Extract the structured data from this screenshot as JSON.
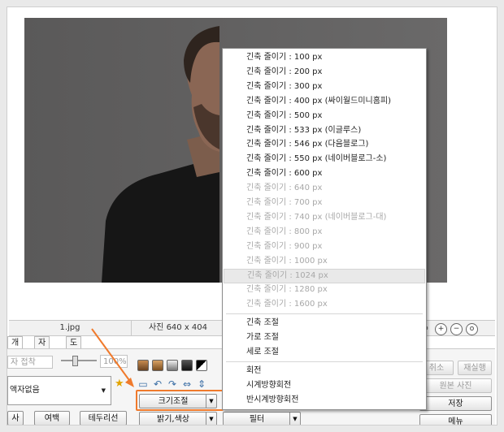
{
  "photo": {
    "background": "#605f5f"
  },
  "status": {
    "filename": "1.jpg",
    "dimensions": "사진 640 x 404",
    "zoom_suffix": "%"
  },
  "tabs": [
    {
      "label": "개체"
    },
    {
      "label": "자르기"
    },
    {
      "label": "도구"
    }
  ],
  "left_panel": {
    "partial_input": "자 접착",
    "slider_value": "100%",
    "frame_select_value": "액자없음",
    "button_photo": "사진",
    "button_margin": "여백",
    "button_border": "테두리선"
  },
  "center_panel": {
    "resize_button": "크기조절",
    "brightness_button": "밝기,색상",
    "filter_button": "필터"
  },
  "right_panel": {
    "cancel": "취소",
    "redo": "재실행",
    "original": "원본 사진",
    "save": "저장",
    "menu": "메뉴"
  },
  "resize_menu": {
    "items": [
      {
        "label": "긴축 줄이기 : 100 px",
        "disabled": false
      },
      {
        "label": "긴축 줄이기 : 200 px",
        "disabled": false
      },
      {
        "label": "긴축 줄이기 : 300 px",
        "disabled": false
      },
      {
        "label": "긴축 줄이기 : 400 px (싸이월드미니홈피)",
        "disabled": false
      },
      {
        "label": "긴축 줄이기 : 500 px",
        "disabled": false
      },
      {
        "label": "긴축 줄이기 : 533 px (이글루스)",
        "disabled": false
      },
      {
        "label": "긴축 줄이기 : 546 px (다음블로그)",
        "disabled": false
      },
      {
        "label": "긴축 줄이기 : 550 px (네이버블로그-소)",
        "disabled": false
      },
      {
        "label": "긴축 줄이기 : 600 px",
        "disabled": false
      },
      {
        "label": "긴축 줄이기 : 640 px",
        "disabled": true
      },
      {
        "label": "긴축 줄이기 : 700 px",
        "disabled": true
      },
      {
        "label": "긴축 줄이기 : 740 px (네이버블로그-대)",
        "disabled": true
      },
      {
        "label": "긴축 줄이기 : 800 px",
        "disabled": true
      },
      {
        "label": "긴축 줄이기 : 900 px",
        "disabled": true
      },
      {
        "label": "긴축 줄이기 : 1000 px",
        "disabled": true
      },
      {
        "label": "긴축 줄이기 : 1024 px",
        "disabled": true,
        "highlighted": true
      },
      {
        "label": "긴축 줄이기 : 1280 px",
        "disabled": true
      },
      {
        "label": "긴축 줄이기 : 1600 px",
        "disabled": true
      }
    ],
    "group2": [
      {
        "label": "긴축 조절"
      },
      {
        "label": "가로 조절"
      },
      {
        "label": "세로 조절"
      }
    ],
    "group3": [
      {
        "label": "회전"
      },
      {
        "label": "시계방향회전"
      },
      {
        "label": "반시계방향회전"
      }
    ]
  },
  "colors": {
    "highlight_outline": "#f07a2c",
    "arrow": "#f07a2c"
  }
}
